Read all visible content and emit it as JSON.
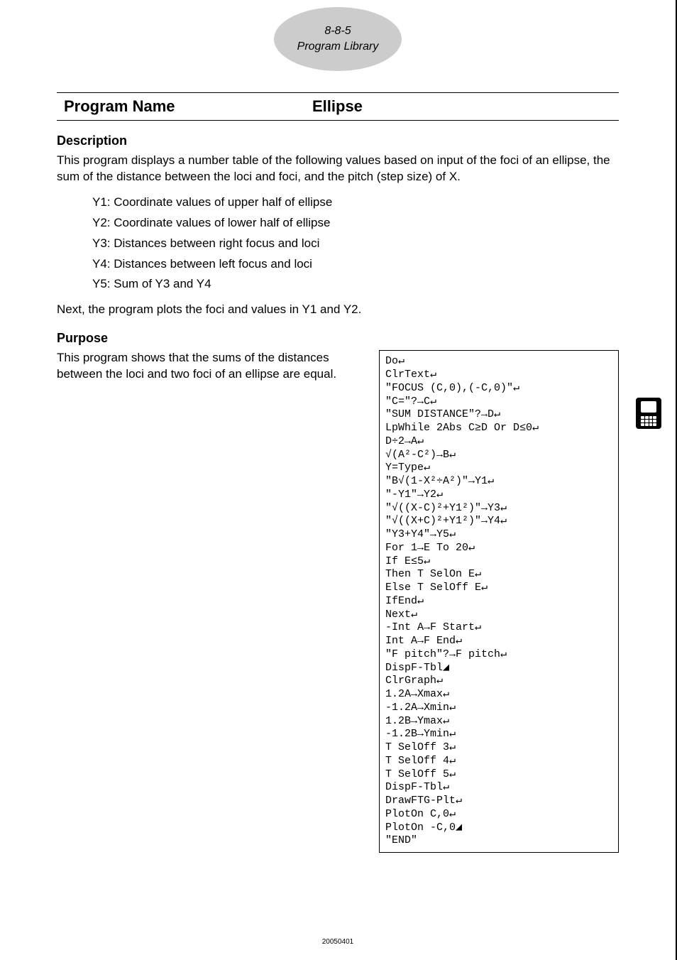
{
  "header": {
    "page_ref": "8-8-5",
    "section": "Program Library"
  },
  "title": {
    "label": "Program Name",
    "value": "Ellipse"
  },
  "description": {
    "heading": "Description",
    "text": "This program displays a number table of the following values based on input of the foci of an ellipse, the sum of the distance between the loci and foci, and the pitch (step size) of X.",
    "items": [
      "Y1:  Coordinate values of upper half of ellipse",
      "Y2:  Coordinate values of lower half of ellipse",
      "Y3:  Distances between right focus and loci",
      "Y4:  Distances between left focus and loci",
      "Y5:  Sum of Y3 and Y4"
    ],
    "after": "Next, the program plots the foci and values in Y1 and Y2."
  },
  "purpose": {
    "heading": "Purpose",
    "text": "This program shows that the sums of the distances between the loci and two foci of an ellipse are equal."
  },
  "code": "Do↵\nClrText↵\n\"FOCUS (C,0),(-C,0)\"↵\n\"C=\"?→C↵\n\"SUM DISTANCE\"?→D↵\nLpWhile 2Abs C≥D Or D≤0↵\nD÷2→A↵\n√(A²-C²)→B↵\nY=Type↵\n\"B√(1-X²÷A²)\"→Y1↵\n\"-Y1\"→Y2↵\n\"√((X-C)²+Y1²)\"→Y3↵\n\"√((X+C)²+Y1²)\"→Y4↵\n\"Y3+Y4\"→Y5↵\nFor 1→E To 20↵\nIf E≤5↵\nThen T SelOn E↵\nElse T SelOff E↵\nIfEnd↵\nNext↵\n-Int A→F Start↵\nInt A→F End↵\n\"F pitch\"?→F pitch↵\nDispF-Tbl◢\nClrGraph↵\n1.2A→Xmax↵\n-1.2A→Xmin↵\n1.2B→Ymax↵\n-1.2B→Ymin↵\nT SelOff 3↵\nT SelOff 4↵\nT SelOff 5↵\nDispF-Tbl↵\nDrawFTG-Plt↵\nPlotOn C,0↵\nPlotOn -C,0◢\n\"END\"",
  "footer": "20050401"
}
